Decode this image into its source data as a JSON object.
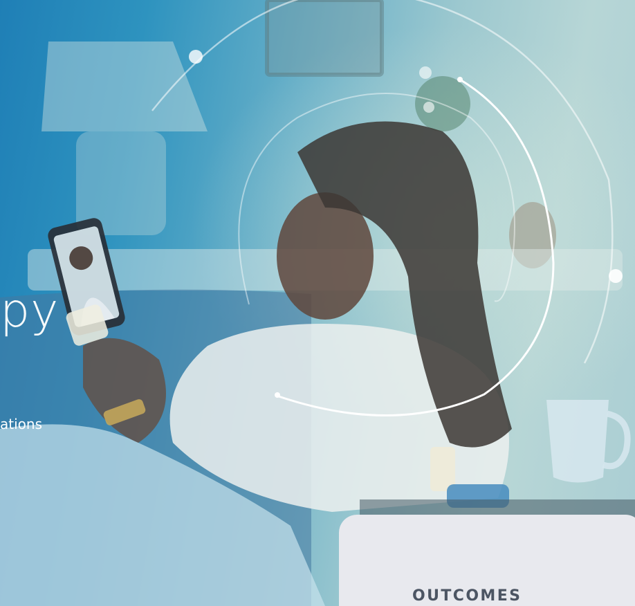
{
  "hero": {
    "headline_fragment": "py",
    "subtext_fragment": "ations",
    "colors": {
      "overlay_blue": "#2e93bf",
      "overlay_teal": "#9cc8cf",
      "card_bg": "#e8e9ee",
      "card_text": "#4c5563",
      "arc_stroke": "#ffffff"
    }
  },
  "outcomes_card": {
    "label": "OUTCOMES"
  }
}
